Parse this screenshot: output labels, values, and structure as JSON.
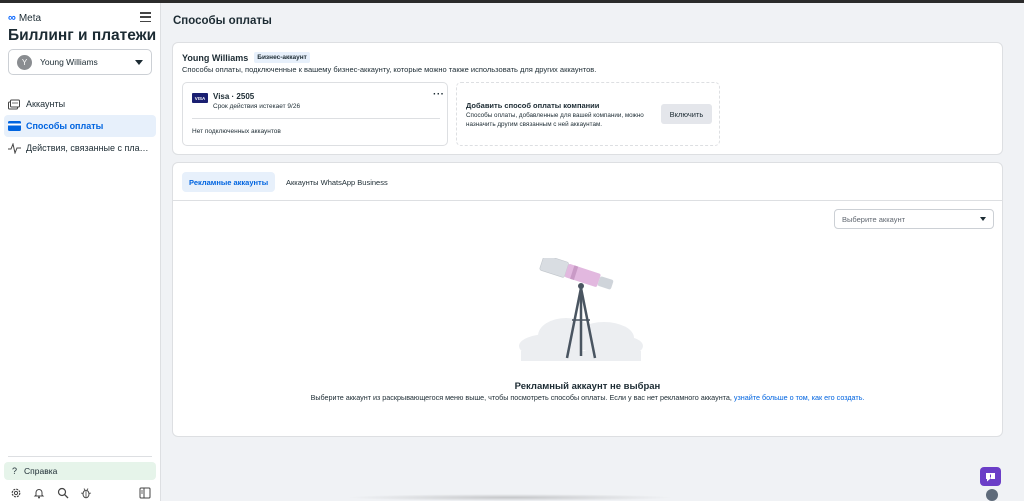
{
  "brand": {
    "logo_text": "Meta"
  },
  "sidebar": {
    "app_title": "Биллинг и платежи",
    "account_selector": {
      "avatar_letter": "Y",
      "name": "Young Williams"
    },
    "items": [
      {
        "label": "Аккаунты",
        "icon": "accounts-icon",
        "active": false
      },
      {
        "label": "Способы оплаты",
        "icon": "card-icon",
        "active": true
      },
      {
        "label": "Действия, связанные с плате...",
        "icon": "activity-icon",
        "active": false
      }
    ],
    "help_label": "Справка",
    "bottom_icons": [
      "gear-icon",
      "bell-icon",
      "search-icon",
      "bug-icon",
      "panel-icon"
    ]
  },
  "main": {
    "page_title": "Способы оплаты",
    "payment_card": {
      "owner_name": "Young Williams",
      "badge": "Бизнес-аккаунт",
      "description": "Способы оплаты, подключенные к вашему бизнес-аккаунту, которые можно также использовать для других аккаунтов.",
      "visa": {
        "logo": "VISA",
        "number": "Visa · 2505",
        "expiry": "Срок действия истекает 9/26",
        "more": "···",
        "note": "Нет подключенных аккаунтов"
      },
      "add_method": {
        "title": "Добавить способ оплаты компании",
        "description": "Способы оплаты, добавленные для вашей компании, можно назначить другим связанным с ней аккаунтам.",
        "button": "Включить"
      }
    },
    "accounts_card": {
      "tabs": [
        {
          "label": "Рекламные аккаунты",
          "active": true
        },
        {
          "label": "Аккаунты WhatsApp Business",
          "active": false
        }
      ],
      "dropdown_placeholder": "Выберите аккаунт",
      "empty_title": "Рекламный аккаунт не выбран",
      "empty_desc": "Выберите аккаунт из раскрывающегося меню выше, чтобы посмотреть способы оплаты. Если у вас нет рекламного аккаунта,",
      "empty_link": "узнайте больше о том, как его создать."
    }
  },
  "colors": {
    "accent": "#0064e0",
    "active_bg": "#e7f0fb",
    "help_bg": "#e6f4ea",
    "chat_fab": "#6b3ec7"
  }
}
